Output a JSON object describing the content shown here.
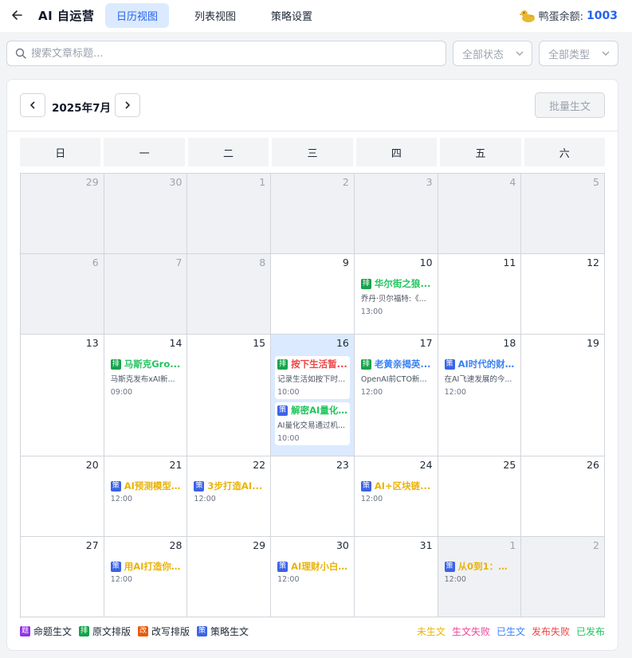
{
  "header": {
    "title": "AI 自运营",
    "tabs": [
      {
        "label": "日历视图",
        "active": true
      },
      {
        "label": "列表视图",
        "active": false
      },
      {
        "label": "策略设置",
        "active": false
      }
    ],
    "balance_label": "鸭蛋余额:",
    "balance_value": "1003"
  },
  "filters": {
    "search_placeholder": "搜索文章标题...",
    "status_select": "全部状态",
    "type_select": "全部类型"
  },
  "calendar": {
    "month_label": "2025年7月",
    "batch_button": "批量生文",
    "weekdays": [
      "日",
      "一",
      "二",
      "三",
      "四",
      "五",
      "六"
    ],
    "days": [
      {
        "n": "29",
        "other": true
      },
      {
        "n": "30",
        "other": true
      },
      {
        "n": "1",
        "other": true
      },
      {
        "n": "2",
        "other": true
      },
      {
        "n": "3",
        "other": true
      },
      {
        "n": "4",
        "other": true
      },
      {
        "n": "5",
        "other": true
      },
      {
        "n": "6",
        "other": true
      },
      {
        "n": "7",
        "other": true
      },
      {
        "n": "8",
        "other": true
      },
      {
        "n": "9"
      },
      {
        "n": "10",
        "events": [
          {
            "type": "排",
            "title": "华尔街之狼...",
            "desc": "乔丹·贝尔福特:《...",
            "time": "13:00",
            "status": "published"
          }
        ]
      },
      {
        "n": "11"
      },
      {
        "n": "12"
      },
      {
        "n": "13"
      },
      {
        "n": "14",
        "events": [
          {
            "type": "排",
            "title": "马斯克Gro...",
            "desc": "马斯克发布xAI新...",
            "time": "09:00",
            "status": "published"
          }
        ]
      },
      {
        "n": "15"
      },
      {
        "n": "16",
        "today": true,
        "events": [
          {
            "type": "排",
            "title": "按下生活暂...",
            "desc": "记录生活如按下时...",
            "time": "10:00",
            "status": "publish_failed"
          },
          {
            "type": "策",
            "title": "解密AI量化...",
            "desc": "AI量化交易通过机...",
            "time": "10:00",
            "status": "published"
          }
        ]
      },
      {
        "n": "17",
        "events": [
          {
            "type": "排",
            "title": "老黄亲揭英...",
            "desc": "OpenAI前CTO新...",
            "time": "12:00",
            "status": "generated"
          }
        ]
      },
      {
        "n": "18",
        "events": [
          {
            "type": "策",
            "title": "AI时代的财...",
            "desc": "在AI飞速发展的今...",
            "time": "12:00",
            "status": "generated"
          }
        ]
      },
      {
        "n": "19"
      },
      {
        "n": "20"
      },
      {
        "n": "21",
        "events": [
          {
            "type": "策",
            "title": "AI预测模型...",
            "time": "12:00",
            "status": "not_generated"
          }
        ]
      },
      {
        "n": "22",
        "events": [
          {
            "type": "策",
            "title": "3步打造AI...",
            "time": "12:00",
            "status": "not_generated"
          }
        ]
      },
      {
        "n": "23"
      },
      {
        "n": "24",
        "events": [
          {
            "type": "策",
            "title": "AI+区块链...",
            "time": "12:00",
            "status": "not_generated"
          }
        ]
      },
      {
        "n": "25"
      },
      {
        "n": "26"
      },
      {
        "n": "27"
      },
      {
        "n": "28",
        "events": [
          {
            "type": "策",
            "title": "用AI打造你...",
            "time": "12:00",
            "status": "not_generated"
          }
        ]
      },
      {
        "n": "29"
      },
      {
        "n": "30",
        "events": [
          {
            "type": "策",
            "title": "AI理财小白...",
            "time": "12:00",
            "status": "not_generated"
          }
        ]
      },
      {
        "n": "31"
      },
      {
        "n": "1",
        "other": true,
        "events": [
          {
            "type": "策",
            "title": "从0到1：AI...",
            "time": "12:00",
            "status": "not_generated"
          }
        ]
      },
      {
        "n": "2",
        "other": true
      }
    ]
  },
  "legend": {
    "types": [
      {
        "badge": "题",
        "label": "命题生文",
        "color": "#9333ea"
      },
      {
        "badge": "排",
        "label": "原文排版",
        "color": "#16a34a"
      },
      {
        "badge": "改",
        "label": "改写排版",
        "color": "#ea580c"
      },
      {
        "badge": "策",
        "label": "策略生文",
        "color": "#3b63e6"
      }
    ],
    "statuses": [
      {
        "label": "未生文",
        "color": "#eab308"
      },
      {
        "label": "生文失败",
        "color": "#ec4899"
      },
      {
        "label": "已生文",
        "color": "#3b82f6"
      },
      {
        "label": "发布失败",
        "color": "#ef4444"
      },
      {
        "label": "已发布",
        "color": "#22c55e"
      }
    ]
  },
  "colors": {
    "type": {
      "题": "#9333ea",
      "排": "#16a34a",
      "改": "#ea580c",
      "策": "#3b63e6"
    },
    "status": {
      "not_generated": "#eab308",
      "generate_failed": "#ec4899",
      "generated": "#3b82f6",
      "publish_failed": "#ef4444",
      "published": "#22c55e"
    }
  }
}
